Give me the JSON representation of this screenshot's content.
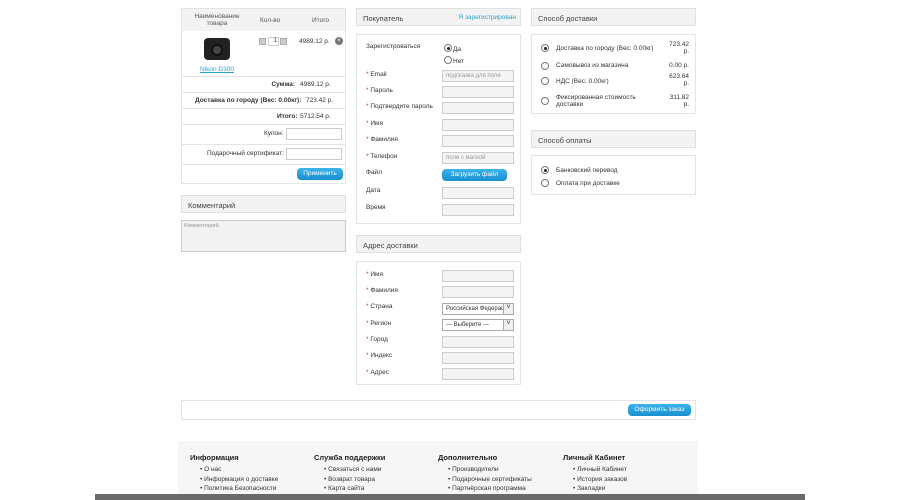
{
  "cart": {
    "col_name": "Наименование товара",
    "col_qty": "Кол-во",
    "col_total": "Итого",
    "product": {
      "name": "Nikon D300",
      "qty": "1",
      "price": "4989.12 р."
    },
    "sum_label": "Сумма:",
    "sum_value": "4989.12 р.",
    "delivery_label": "Доставка по городу (Вес: 0.00кг):",
    "delivery_value": "723.42 р.",
    "total_label": "Итого:",
    "total_value": "5712.54 р.",
    "coupon_label": "Купон:",
    "certificate_label": "Подарочный сертификат:",
    "apply_button": "Применить"
  },
  "comment": {
    "title": "Комментарий",
    "placeholder": "Комментарий"
  },
  "buyer": {
    "title": "Покупатель",
    "registered_link": "Я зарегистрирован",
    "register_label": "Зарегистроваться",
    "yes": "Да",
    "no": "Нет",
    "email_label": "Email",
    "email_placeholder": "подсказка для поля",
    "password_label": "Пароль",
    "confirm_label": "Подтвердите пароль",
    "name_label": "Имя",
    "surname_label": "Фамилия",
    "phone_label": "Телефон",
    "phone_placeholder": "поле с маской",
    "file_label": "Файл",
    "upload_button": "Загрузить файл",
    "date_label": "Дата",
    "time_label": "Время"
  },
  "address": {
    "title": "Адрес доставки",
    "name_label": "Имя",
    "surname_label": "Фамилия",
    "country_label": "Страна",
    "country_value": "Российская Федерация",
    "region_label": "Регион",
    "region_value": "--- Выберите ---",
    "city_label": "Город",
    "index_label": "Индекс",
    "address_label": "Адрес"
  },
  "shipping": {
    "title": "Способ доставки",
    "options": [
      {
        "label": "Доставка по городу (Вес: 0.00кг)",
        "price": "723.42 р.",
        "selected": true
      },
      {
        "label": "Самовывоз из магазина",
        "price": "0.00 р.",
        "selected": false
      },
      {
        "label": "НДС (Вес: 0.00кг)",
        "price": "623.64 р.",
        "selected": false
      },
      {
        "label": "Фиксированная стоимость доставки",
        "price": "311.82 р.",
        "selected": false
      }
    ]
  },
  "payment": {
    "title": "Способ оплаты",
    "options": [
      {
        "label": "Банковский перевод",
        "selected": true
      },
      {
        "label": "Оплата при доставке",
        "selected": false
      }
    ]
  },
  "order_button": "Оформить заказ",
  "footer": [
    {
      "title": "Информация",
      "links": [
        "О нас",
        "Информация о доставке",
        "Политика Безопасности"
      ]
    },
    {
      "title": "Служба поддержки",
      "links": [
        "Связаться с нами",
        "Возврат товара",
        "Карта сайта"
      ]
    },
    {
      "title": "Дополнительно",
      "links": [
        "Производители",
        "Подарочные сертификаты",
        "Партнёрская программа"
      ]
    },
    {
      "title": "Личный Кабинет",
      "links": [
        "Личный Кабинет",
        "История заказов",
        "Закладки"
      ]
    }
  ]
}
